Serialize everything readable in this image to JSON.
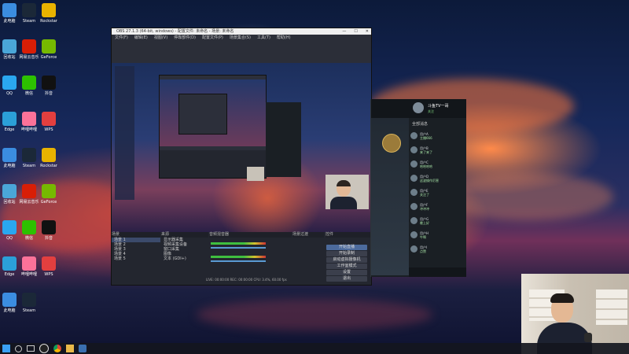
{
  "desktop": {
    "icons": [
      {
        "label": "此电脑",
        "color": "#3b8de0"
      },
      {
        "label": "Steam",
        "color": "#1b2838"
      },
      {
        "label": "Rockstar",
        "color": "#e9b300"
      },
      {
        "label": "回收站",
        "color": "#4aa6d8"
      },
      {
        "label": "网易云音乐",
        "color": "#d81e06"
      },
      {
        "label": "GeForce",
        "color": "#76b900"
      },
      {
        "label": "QQ",
        "color": "#2aa7f0"
      },
      {
        "label": "微信",
        "color": "#2dc100"
      },
      {
        "label": "抖音",
        "color": "#111111"
      },
      {
        "label": "Edge",
        "color": "#2b9fd8"
      },
      {
        "label": "哔哩哔哩",
        "color": "#fb7299"
      },
      {
        "label": "WPS",
        "color": "#e33f3f"
      }
    ]
  },
  "obs": {
    "title": "OBS 27.1.3 (64-bit, windows) - 配置文件: 未命名 - 场景: 未命名",
    "menu": [
      "文件(F)",
      "编辑(E)",
      "视图(V)",
      "停靠部件(D)",
      "配置文件(P)",
      "场景集合(S)",
      "工具(T)",
      "帮助(H)"
    ],
    "docks": {
      "scenes": "场景",
      "sources": "来源",
      "mixer": "音频混音器",
      "transitions": "场景过渡",
      "controls": "控件"
    },
    "scene_list": [
      "场景 1",
      "场景 2",
      "场景 3",
      "场景 4",
      "场景 5"
    ],
    "source_list": [
      "显示器采集",
      "视频采集设备",
      "窗口采集",
      "图像",
      "文本 (GDI+)"
    ],
    "controls": [
      "开始直播",
      "开始录制",
      "启动虚拟摄像机",
      "工作室模式",
      "设置",
      "退出"
    ],
    "status": "LIVE: 00:00:00   REC: 00:00:00   CPU: 3.4%, 60.00 fps"
  },
  "chat": {
    "streamer": "斗鱼TV一哥",
    "followers": "关注",
    "tab": "全部消息",
    "messages": [
      {
        "name": "用户A",
        "text": "主播666"
      },
      {
        "name": "用户B",
        "text": "来了来了"
      },
      {
        "name": "用户C",
        "text": "哈哈哈哈"
      },
      {
        "name": "用户D",
        "text": "这波操作厉害"
      },
      {
        "name": "用户E",
        "text": "关注了"
      },
      {
        "name": "用户F",
        "text": "冲冲冲"
      },
      {
        "name": "用户G",
        "text": "晚上好"
      },
      {
        "name": "用户H",
        "text": "牛啊"
      },
      {
        "name": "用户I",
        "text": "点赞"
      }
    ]
  },
  "webcam": {
    "label": ""
  },
  "taskbar": {
    "icons": [
      "windows-start",
      "search",
      "task-view",
      "obs",
      "chrome",
      "file-explorer",
      "game"
    ]
  }
}
